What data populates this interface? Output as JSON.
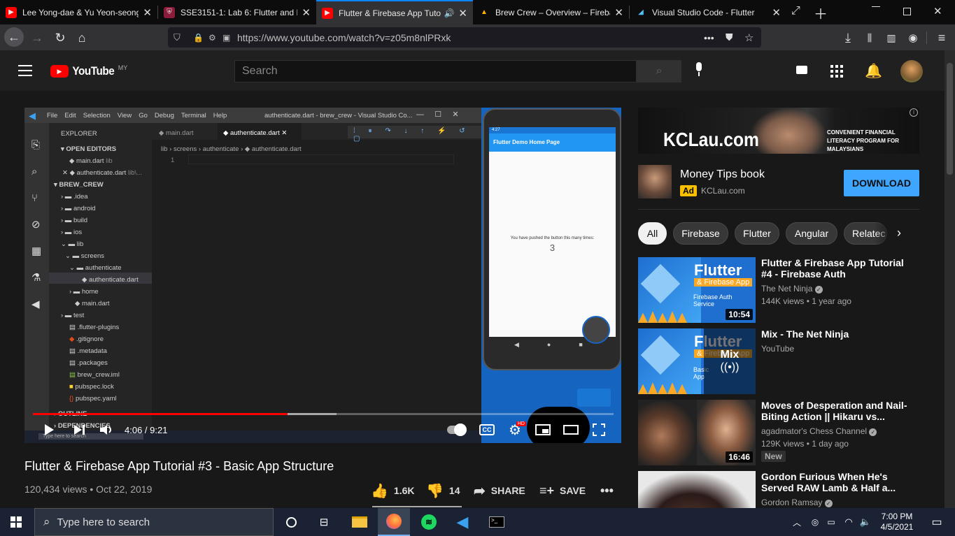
{
  "browser": {
    "tabs": [
      {
        "title": "Lee Yong-dae & Yu Yeon-seong",
        "active": false
      },
      {
        "title": "SSE3151-1: Lab 6: Flutter and Fi",
        "active": false
      },
      {
        "title": "Flutter & Firebase App Tuto",
        "active": true
      },
      {
        "title": "Brew Crew – Overview – Fireba",
        "active": false
      },
      {
        "title": "Visual Studio Code - Flutter",
        "active": false
      }
    ],
    "url": "https://www.youtube.com/watch?v=z05m8nlPRxk"
  },
  "youtube": {
    "logo_text": "YouTube",
    "region": "MY",
    "search_placeholder": "Search"
  },
  "video": {
    "time": "4:06 / 9:21",
    "progress": 0.438,
    "buffered": 0.523,
    "title": "Flutter & Firebase App Tutorial #3 - Basic App Structure",
    "meta": "120,434 views • Oct 22, 2019",
    "likes": "1.6K",
    "dislikes": "14",
    "share_label": "SHARE",
    "save_label": "SAVE"
  },
  "vscode": {
    "menu": [
      "File",
      "Edit",
      "Selection",
      "View",
      "Go",
      "Debug",
      "Terminal",
      "Help"
    ],
    "window_title": "authenticate.dart - brew_crew - Visual Studio Co...",
    "explorer_label": "EXPLORER",
    "open_editors_label": "OPEN EDITORS",
    "open_editors": [
      {
        "name": "main.dart",
        "hint": "lib"
      },
      {
        "name": "authenticate.dart",
        "hint": "lib\\..."
      }
    ],
    "project_label": "BREW_CREW",
    "tree": [
      ".idea",
      "android",
      "build",
      "ios",
      "lib",
      "screens",
      "authenticate",
      "authenticate.dart",
      "home",
      "main.dart",
      "test",
      ".flutter-plugins",
      ".gitignore",
      ".metadata",
      ".packages",
      "brew_crew.iml",
      "pubspec.lock",
      "pubspec.yaml"
    ],
    "outline_label": "OUTLINE",
    "dependencies_label": "DEPENDENCIES",
    "editor_tabs": [
      "main.dart",
      "authenticate.dart"
    ],
    "breadcrumb": [
      "lib",
      "screens",
      "authenticate",
      "authenticate.dart"
    ],
    "line_number": "1",
    "taskbar_search": "Type here to search"
  },
  "phone": {
    "time": "4:27",
    "appbar_title": "Flutter Demo Home Page",
    "message": "You have pushed the button this many times:",
    "counter": "3"
  },
  "ad": {
    "banner_brand": "KCLau.com",
    "banner_tagline": "CONVENIENT FINANCIAL LITERACY PROGRAM FOR MALAYSIANS",
    "title": "Money Tips book",
    "badge": "Ad",
    "domain": "KCLau.com",
    "cta": "DOWNLOAD"
  },
  "chips": [
    "All",
    "Firebase",
    "Flutter",
    "Angular",
    "Relatec"
  ],
  "recommendations": [
    {
      "title": "Flutter & Firebase App Tutorial #4 - Firebase Auth",
      "channel": "The Net Ninja",
      "verified": true,
      "stats": "144K views • 1 year ago",
      "duration": "10:54",
      "thumb_heading": "Flutter",
      "thumb_sub": "& Firebase App",
      "thumb_caption": "Firebase Auth Service"
    },
    {
      "title": "Mix - The Net Ninja",
      "channel": "YouTube",
      "verified": false,
      "stats": "",
      "duration": "",
      "thumb_heading": "Flutter",
      "thumb_sub": "& Firebase App",
      "thumb_caption": "Basic App Structure",
      "mix_label": "Mix"
    },
    {
      "title": "Moves of Desperation and Nail-Biting Action || Hikaru vs...",
      "channel": "agadmator's Chess Channel",
      "verified": true,
      "stats": "129K views • 1 day ago",
      "duration": "16:46",
      "badge": "New"
    },
    {
      "title": "Gordon Furious When He's Served RAW Lamb & Half a...",
      "channel": "Gordon Ramsay",
      "verified": true,
      "stats": "",
      "duration": ""
    }
  ],
  "taskbar": {
    "search_placeholder": "Type here to search",
    "time": "7:00 PM",
    "date": "4/5/2021"
  }
}
